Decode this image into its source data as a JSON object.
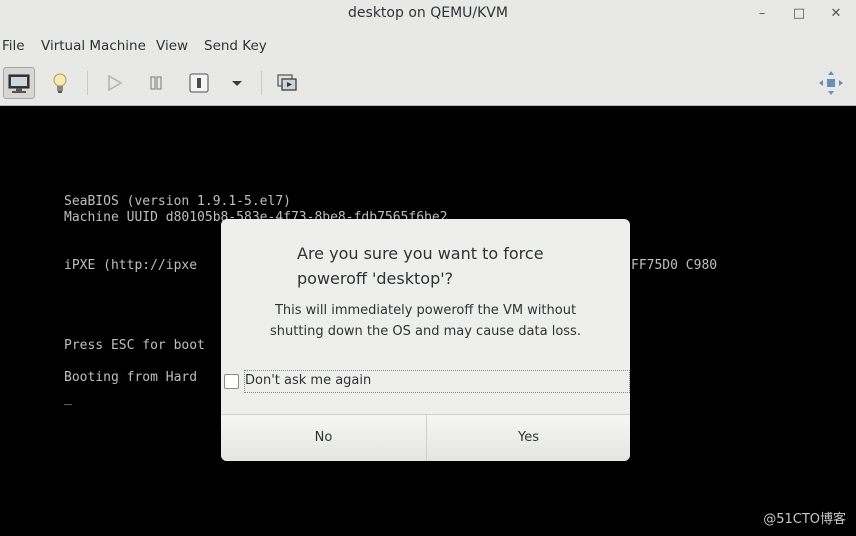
{
  "window": {
    "title": "desktop on QEMU/KVM",
    "controls": [
      "minimize-icon",
      "maximize-icon",
      "close-icon"
    ]
  },
  "menubar": {
    "items": [
      "File",
      "Virtual Machine",
      "View",
      "Send Key"
    ]
  },
  "toolbar": {
    "buttons": [
      "console-icon",
      "details-lightbulb-icon",
      "run-icon",
      "pause-icon",
      "shutdown-icon",
      "shutdown-menu-chevron-icon",
      "snapshots-icon",
      "fullscreen-icon"
    ]
  },
  "console": {
    "lines": [
      "SeaBIOS (version 1.9.1-5.el7)",
      "Machine UUID d80105b8-583e-4f73-8be8-fdb7565f6be2",
      "iPXE (http://ipxe",
      "FF75D0 C980",
      "Press ESC for boot",
      "Booting from Hard",
      "_"
    ]
  },
  "dialog": {
    "title": "Are you sure you want to force poweroff 'desktop'?",
    "message_line1": "This will immediately poweroff the VM without",
    "message_line2": "shutting down the OS and may cause data loss.",
    "checkbox_label": "Don't ask me again",
    "checkbox_checked": false,
    "no_label": "No",
    "yes_label": "Yes"
  },
  "watermark": "@51CTO博客"
}
